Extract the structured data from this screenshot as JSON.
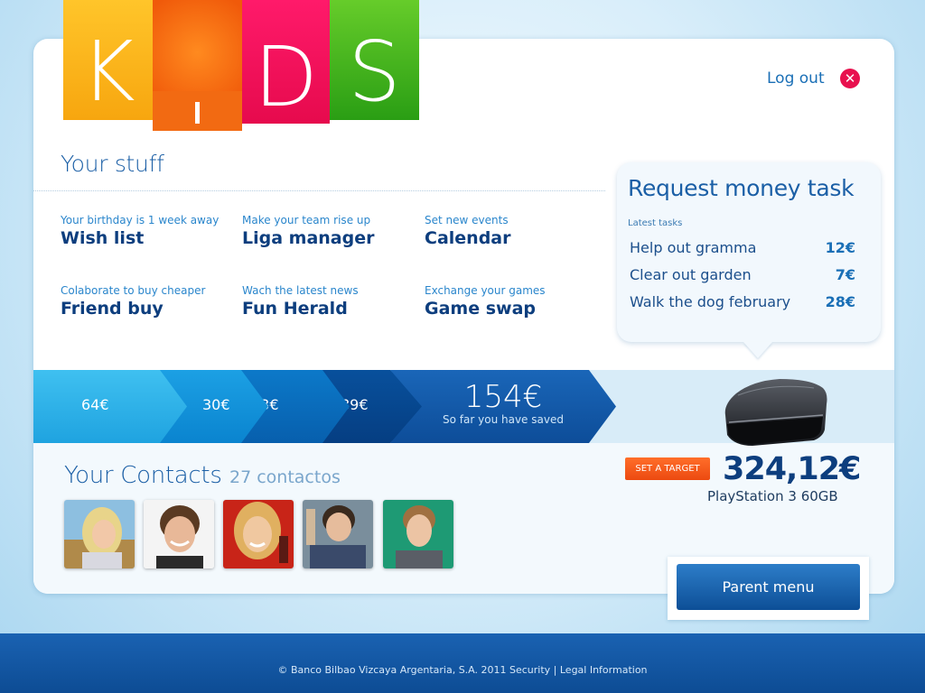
{
  "logo": {
    "letters": [
      "K",
      "i",
      "D",
      "S"
    ]
  },
  "header": {
    "logout_label": "Log out",
    "close_glyph": "✕"
  },
  "your_stuff": {
    "title": "Your stuff",
    "apps": [
      {
        "subtitle": "Your birthday is 1 week away",
        "title": "Wish list"
      },
      {
        "subtitle": "Make your team rise up",
        "title": "Liga manager"
      },
      {
        "subtitle": "Set new events",
        "title": "Calendar"
      },
      {
        "subtitle": "Colaborate to buy cheaper",
        "title": "Friend buy"
      },
      {
        "subtitle": "Wach the latest news",
        "title": "Fun Herald"
      },
      {
        "subtitle": "Exchange your games",
        "title": "Game swap"
      }
    ]
  },
  "request": {
    "title": "Request money task",
    "subtitle": "Latest tasks",
    "tasks": [
      {
        "name": "Help out gramma",
        "amount": "12€"
      },
      {
        "name": "Clear out garden",
        "amount": "7€"
      },
      {
        "name": "Walk the dog february",
        "amount": "28€"
      }
    ]
  },
  "savings": {
    "steps": [
      "64€",
      "30€",
      "23€",
      "89€"
    ],
    "total": "154€",
    "total_label": "So far you have saved"
  },
  "target": {
    "button_label": "SET A TARGET",
    "price": "324,12€",
    "product": "PlayStation 3 60GB",
    "product_icon": "playstation-console-icon"
  },
  "contacts": {
    "title": "Your Contacts",
    "count": "27 contactos",
    "avatars": [
      "contact-1",
      "contact-2",
      "contact-3",
      "contact-4",
      "contact-5"
    ]
  },
  "parent_menu": {
    "label": "Parent menu"
  },
  "footer": {
    "text": "© Banco Bilbao Vizcaya Argentaria, S.A. 2011 Security | Legal Information"
  },
  "colors": {
    "primary_blue": "#1b5fa6",
    "dark_blue": "#0d3e7e",
    "orange": "#ec4a10",
    "logo_yellow": "#ffc52a",
    "logo_orange": "#f05a0a",
    "logo_pink": "#e60a4d",
    "logo_green": "#2a9e14"
  }
}
